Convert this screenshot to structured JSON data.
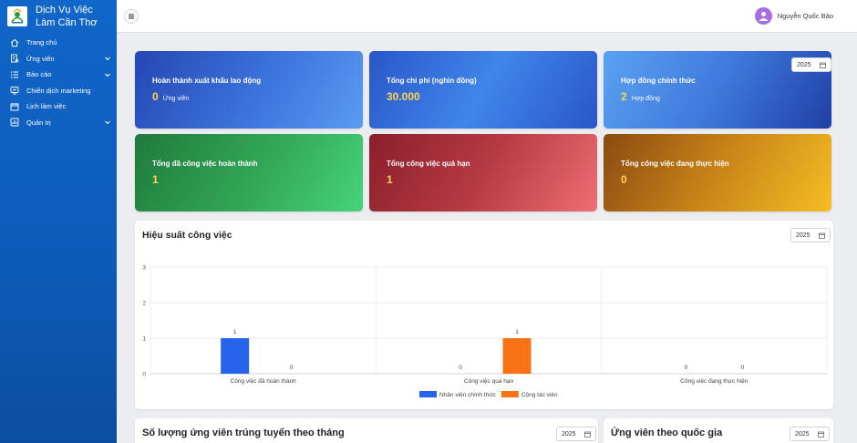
{
  "brand": {
    "name": "Dịch Vụ Việc Làm Cần Thơ"
  },
  "sidebar": {
    "items": [
      {
        "label": "Trang chủ",
        "icon": "home-icon",
        "has_children": false
      },
      {
        "label": "Ứng viên",
        "icon": "applicant-icon",
        "has_children": true
      },
      {
        "label": "Báo cáo",
        "icon": "list-icon",
        "has_children": true
      },
      {
        "label": "Chiến dịch marketing",
        "icon": "campaign-icon",
        "has_children": false
      },
      {
        "label": "Lịch làm việc",
        "icon": "calendar-icon",
        "has_children": false
      },
      {
        "label": "Quản trị",
        "icon": "admin-icon",
        "has_children": true
      }
    ]
  },
  "topbar": {
    "user_name": "Nguyễn Quốc Bảo"
  },
  "cards": [
    {
      "title": "Hoàn thành xuất khẩu lao động",
      "value": "0",
      "unit": "Ứng viên"
    },
    {
      "title": "Tổng chi phí (nghìn đồng)",
      "value": "30.000",
      "unit": ""
    },
    {
      "title": "Hợp đồng chính thức",
      "value": "2",
      "unit": "Hợp đồng",
      "year": "2025"
    },
    {
      "title": "Tổng đã công việc hoàn thành",
      "value": "1",
      "unit": ""
    },
    {
      "title": "Tổng công việc quá hạn",
      "value": "1",
      "unit": ""
    },
    {
      "title": "Tổng công việc đang thực hiện",
      "value": "0",
      "unit": ""
    }
  ],
  "performance": {
    "title": "Hiệu suất công việc",
    "year": "2025"
  },
  "chart_data": {
    "type": "bar",
    "categories": [
      "Công việc đã hoàn thành",
      "Công việc quá hạn",
      "Công việc đang thực hiện"
    ],
    "series": [
      {
        "name": "Nhân viên chính thức",
        "values": [
          1,
          0,
          0
        ],
        "color": "#2563eb"
      },
      {
        "name": "Cộng tác viên",
        "values": [
          0,
          1,
          0
        ],
        "color": "#f97316"
      }
    ],
    "yticks": [
      0,
      1,
      2,
      3
    ],
    "ylim": [
      0,
      3
    ],
    "grid": true,
    "legend": "bottom"
  },
  "monthly": {
    "title": "Số lượng ứng viên trúng tuyển theo tháng",
    "year": "2025"
  },
  "country": {
    "title": "Ứng viên theo quốc gia",
    "year": "2025"
  },
  "colors": {
    "sidebar": "#0d5ab8",
    "value_accent": "#ffd34d"
  }
}
